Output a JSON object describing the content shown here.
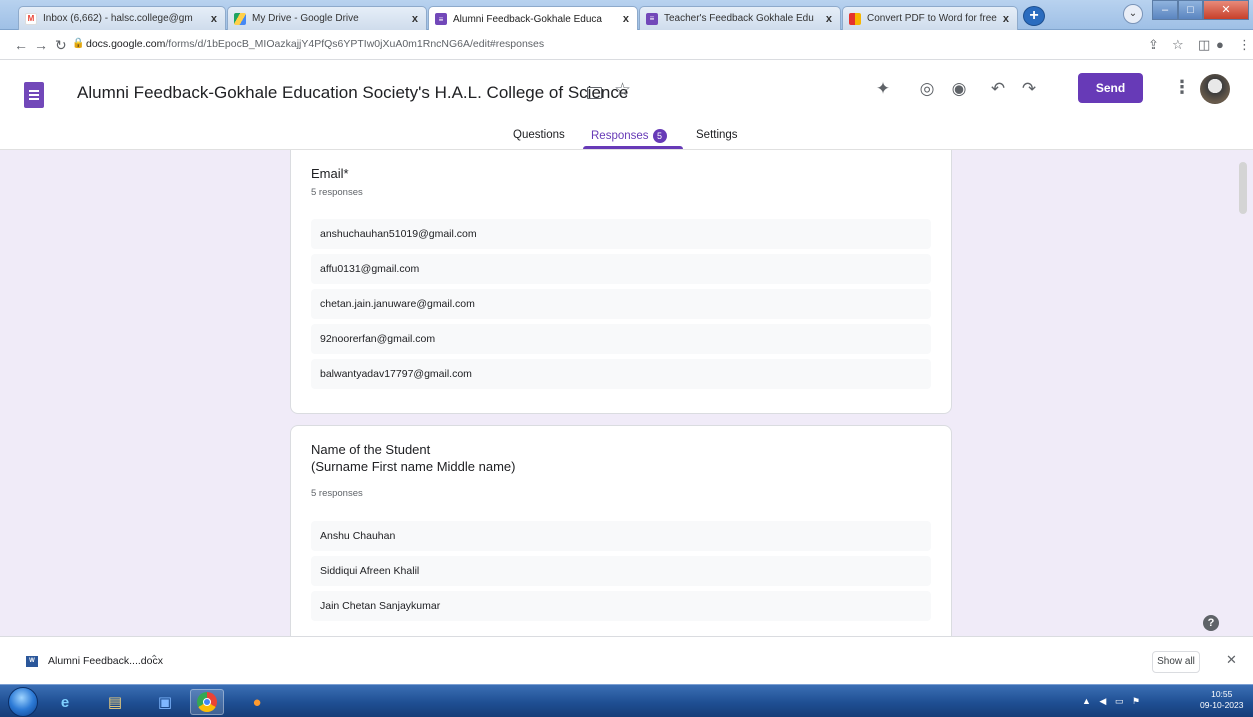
{
  "browser": {
    "tabs": [
      {
        "label": "Inbox (6,662) - halsc.college@gm",
        "icon": "gmail-icon",
        "color": "#ea4335"
      },
      {
        "label": "My Drive - Google Drive",
        "icon": "drive-icon",
        "color": "#1fa463"
      },
      {
        "label": "Alumni Feedback-Gokhale Educa",
        "icon": "forms-icon",
        "color": "#7248b9"
      },
      {
        "label": "Teacher's Feedback Gokhale Edu",
        "icon": "forms-icon",
        "color": "#7248b9"
      },
      {
        "label": "Convert PDF to Word for free | Sm",
        "icon": "smallpdf-icon",
        "color": "#e5322d"
      }
    ],
    "new_tab_symbol": "+",
    "tab_close_symbol": "x",
    "url_host": "docs.google.com",
    "url_path": "/forms/d/1bEpocB_MIOazkajjY4PfQs6YPTIw0jXuA0m1RncNG6A/edit#responses"
  },
  "form": {
    "title": "Alumni Feedback-Gokhale Education Society's H.A.L. College of Science",
    "send_label": "Send",
    "tabs": {
      "questions": "Questions",
      "responses": "Responses",
      "responses_badge": "5",
      "settings": "Settings"
    }
  },
  "questions": [
    {
      "title": "Email*",
      "count_label": "5 responses",
      "responses": [
        "anshuchauhan51019@gmail.com",
        "affu0131@gmail.com",
        "chetan.jain.januware@gmail.com",
        "92noorerfan@gmail.com",
        "balwantyadav17797@gmail.com"
      ]
    },
    {
      "title_line1": "Name of the Student",
      "title_line2": "(Surname First name Middle name)",
      "count_label": "5 responses",
      "responses": [
        "Anshu Chauhan",
        "Siddiqui Afreen Khalil",
        "Jain Chetan Sanjaykumar"
      ]
    }
  ],
  "help_symbol": "?",
  "download": {
    "file_name": "Alumni Feedback....docx",
    "show_all": "Show all"
  },
  "taskbar": {
    "time": "10:55",
    "date": "09-10-2023"
  }
}
